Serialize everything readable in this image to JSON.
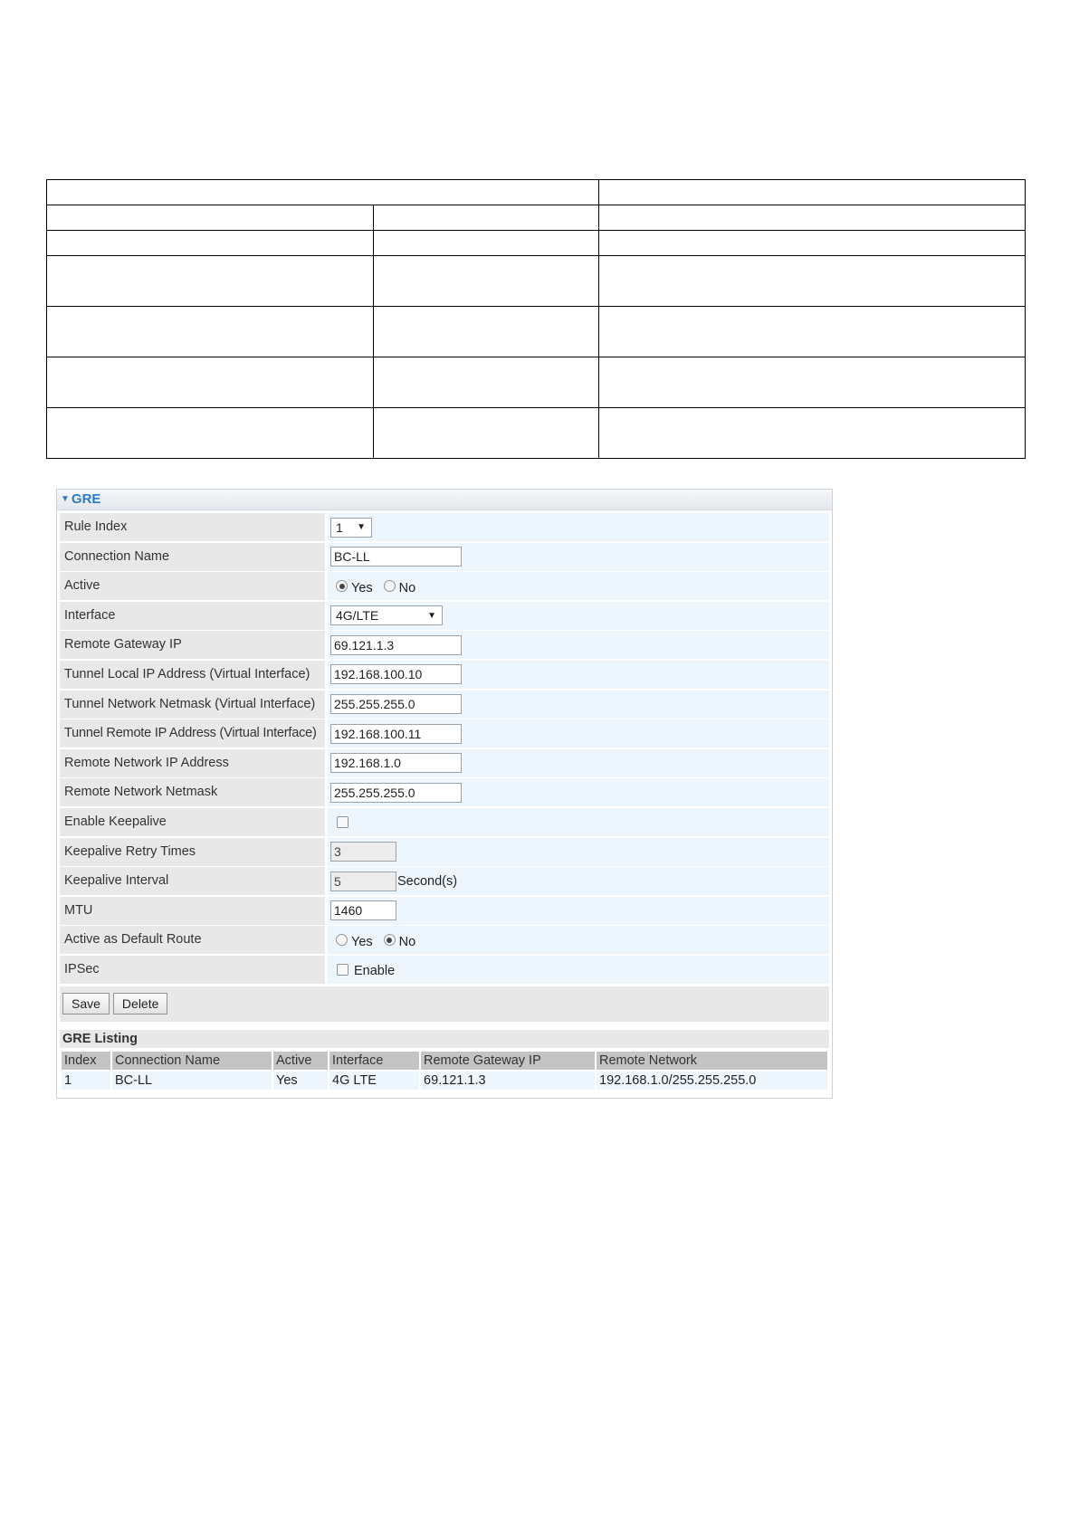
{
  "panel": {
    "title": "GRE"
  },
  "fields": {
    "rule_index": {
      "label": "Rule Index",
      "value": "1"
    },
    "connection_name": {
      "label": "Connection Name",
      "value": "BC-LL"
    },
    "active": {
      "label": "Active",
      "yes": "Yes",
      "no": "No",
      "selected": "Yes"
    },
    "interface": {
      "label": "Interface",
      "value": "4G/LTE"
    },
    "remote_gateway_ip": {
      "label": "Remote Gateway IP",
      "value": "69.121.1.3"
    },
    "tunnel_local_ip": {
      "label": "Tunnel Local IP Address (Virtual Interface)",
      "value": "192.168.100.10"
    },
    "tunnel_netmask": {
      "label": "Tunnel Network Netmask (Virtual Interface)",
      "value": "255.255.255.0"
    },
    "tunnel_remote_ip": {
      "label": "Tunnel Remote IP Address (Virtual Interface)",
      "value": "192.168.100.11"
    },
    "remote_network_ip": {
      "label": "Remote Network IP Address",
      "value": "192.168.1.0"
    },
    "remote_network_netmask": {
      "label": "Remote Network Netmask",
      "value": "255.255.255.0"
    },
    "enable_keepalive": {
      "label": "Enable Keepalive",
      "checked": false
    },
    "keepalive_retry": {
      "label": "Keepalive Retry Times",
      "value": "3"
    },
    "keepalive_interval": {
      "label": "Keepalive Interval",
      "value": "5",
      "unit": "Second(s)"
    },
    "mtu": {
      "label": "MTU",
      "value": "1460"
    },
    "default_route": {
      "label": "Active as Default Route",
      "yes": "Yes",
      "no": "No",
      "selected": "No"
    },
    "ipsec": {
      "label": "IPSec",
      "option": "Enable",
      "checked": false
    }
  },
  "buttons": {
    "save": "Save",
    "delete": "Delete"
  },
  "listing": {
    "title": "GRE Listing",
    "headers": [
      "Index",
      "Connection Name",
      "Active",
      "Interface",
      "Remote Gateway IP",
      "Remote Network"
    ],
    "rows": [
      [
        "1",
        "BC-LL",
        "Yes",
        "4G LTE",
        "69.121.1.3",
        "192.168.1.0/255.255.255.0"
      ]
    ]
  }
}
